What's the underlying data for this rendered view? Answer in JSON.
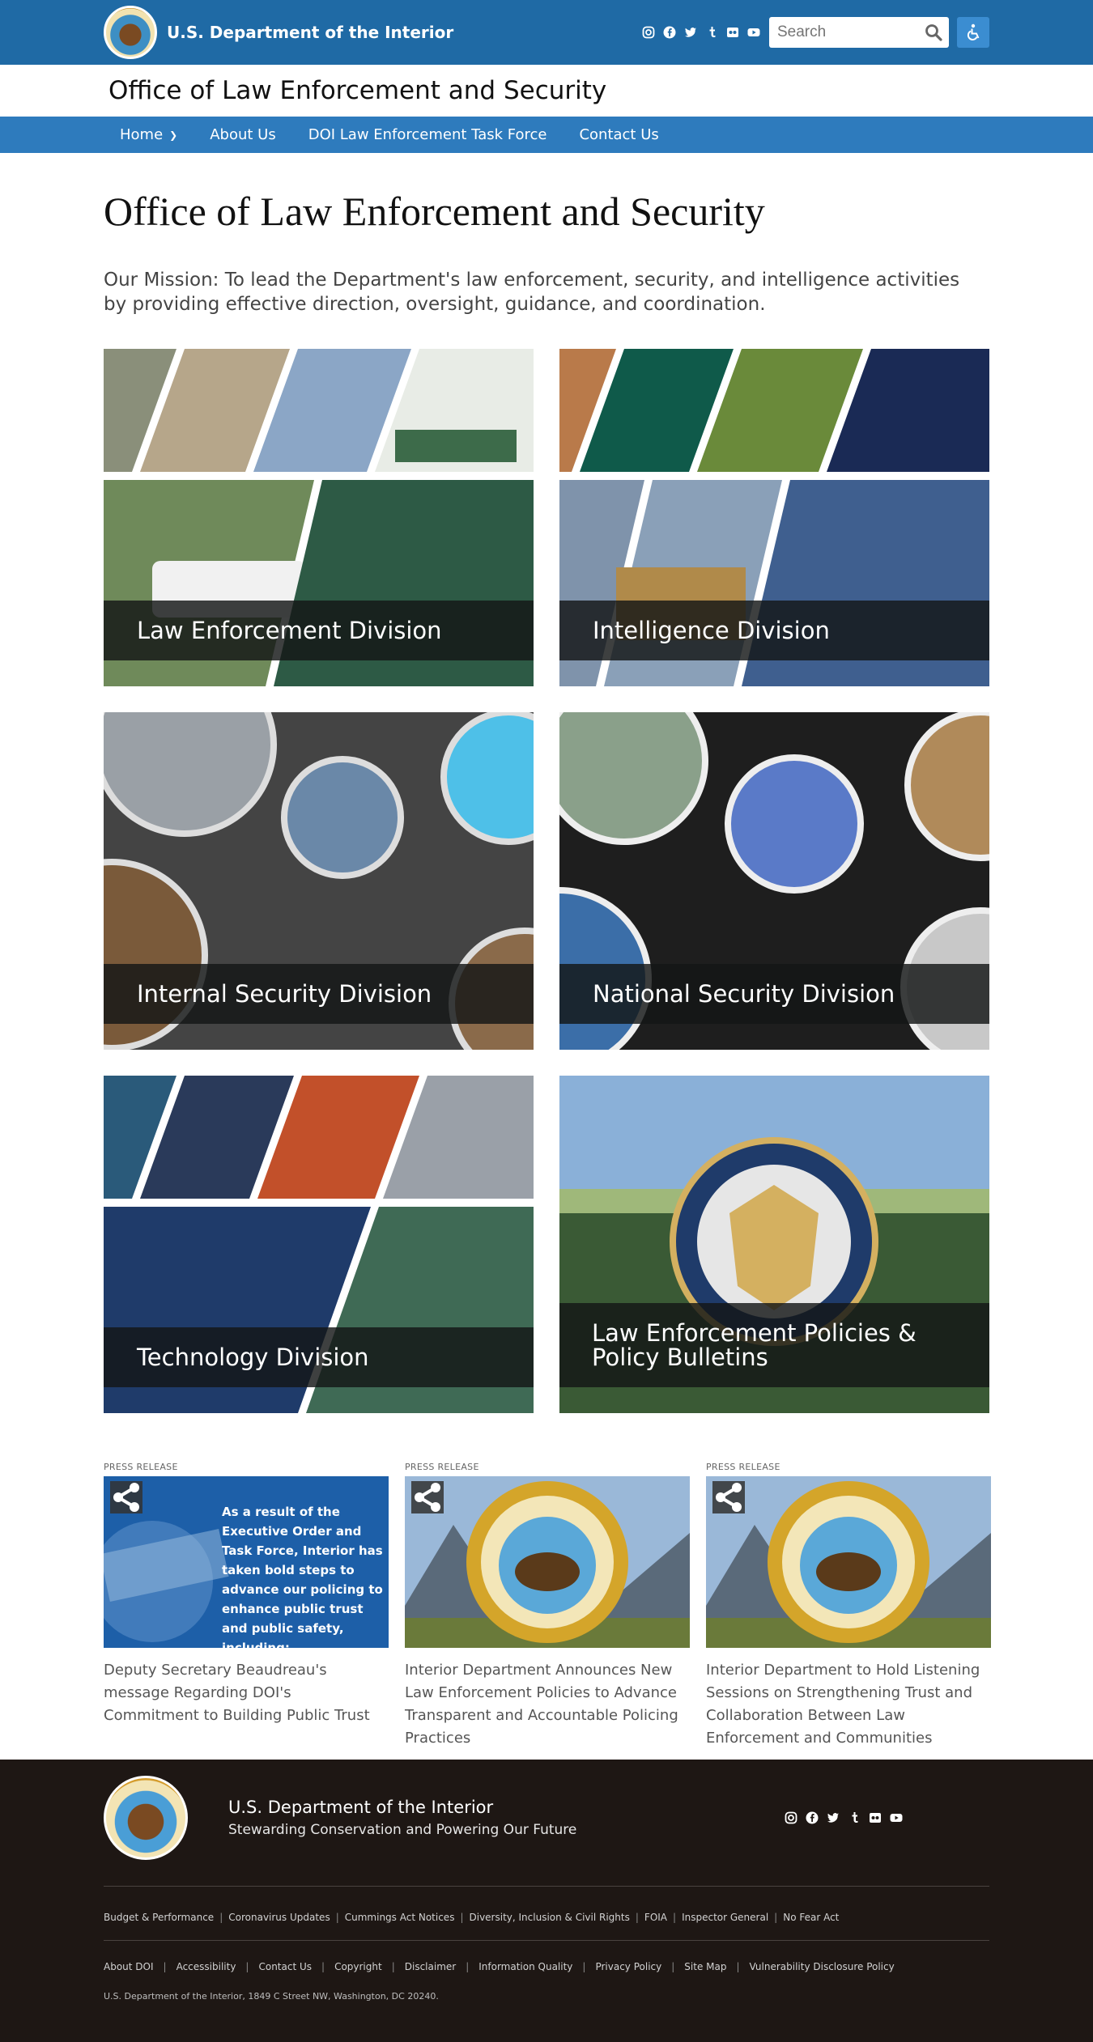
{
  "header": {
    "org_name": "U.S. Department of the Interior",
    "social": [
      "instagram-icon",
      "facebook-icon",
      "twitter-icon",
      "tumblr-icon",
      "flickr-icon",
      "youtube-icon"
    ],
    "search_placeholder": "Search",
    "accessibility_label": "accessibility-icon"
  },
  "office": {
    "title": "Office of Law Enforcement and Security"
  },
  "nav": {
    "items": [
      {
        "label": "Home"
      },
      {
        "label": "About Us"
      },
      {
        "label": "DOI Law Enforcement Task Force"
      },
      {
        "label": "Contact Us"
      }
    ]
  },
  "main": {
    "title": "Office of Law Enforcement and Security",
    "mission": "Our Mission: To lead the Department's law enforcement, security, and intelligence activities by providing effective direction, oversight, guidance, and coordination."
  },
  "tiles": [
    {
      "label": "Law Enforcement Division"
    },
    {
      "label": "Intelligence Division"
    },
    {
      "label": "Internal Security Division"
    },
    {
      "label": "National Security Division"
    },
    {
      "label": "Technology Division"
    },
    {
      "label": "Law Enforcement Policies & Policy Bulletins"
    }
  ],
  "press": [
    {
      "kicker": "PRESS RELEASE",
      "image_text": "As a result of the Executive Order and Task Force, Interior has taken bold steps to advance our policing to enhance public trust and public safety, including:",
      "title": "Deputy Secretary Beaudreau's message Regarding DOI's Commitment to Building Public Trust"
    },
    {
      "kicker": "PRESS RELEASE",
      "title": "Interior Department Announces New Law Enforcement Policies to Advance Transparent and Accountable Policing Practices"
    },
    {
      "kicker": "PRESS RELEASE",
      "title": "Interior Department to Hold Listening Sessions on Strengthening Trust and Collaboration Between Law Enforcement and Communities"
    }
  ],
  "footer": {
    "org_name": "U.S. Department of the Interior",
    "tagline": "Stewarding Conservation and Powering Our Future",
    "links1": [
      "Budget & Performance",
      "Coronavirus Updates",
      "Cummings Act Notices",
      "Diversity, Inclusion & Civil Rights",
      "FOIA",
      "Inspector General",
      "No Fear Act"
    ],
    "links2": [
      "About DOI",
      "Accessibility",
      "Contact Us",
      "Copyright",
      "Disclaimer",
      "Information Quality",
      "Privacy Policy",
      "Site Map",
      "Vulnerability Disclosure Policy"
    ],
    "address": "U.S. Department of the Interior, 1849 C Street NW, Washington, DC 20240."
  },
  "colors": {
    "topbar": "#1f6aa5",
    "nav": "#2e7bbd",
    "footer": "#1e1714",
    "tile_green": "#2d5a45",
    "tile_blue": "#3f5f8f"
  }
}
